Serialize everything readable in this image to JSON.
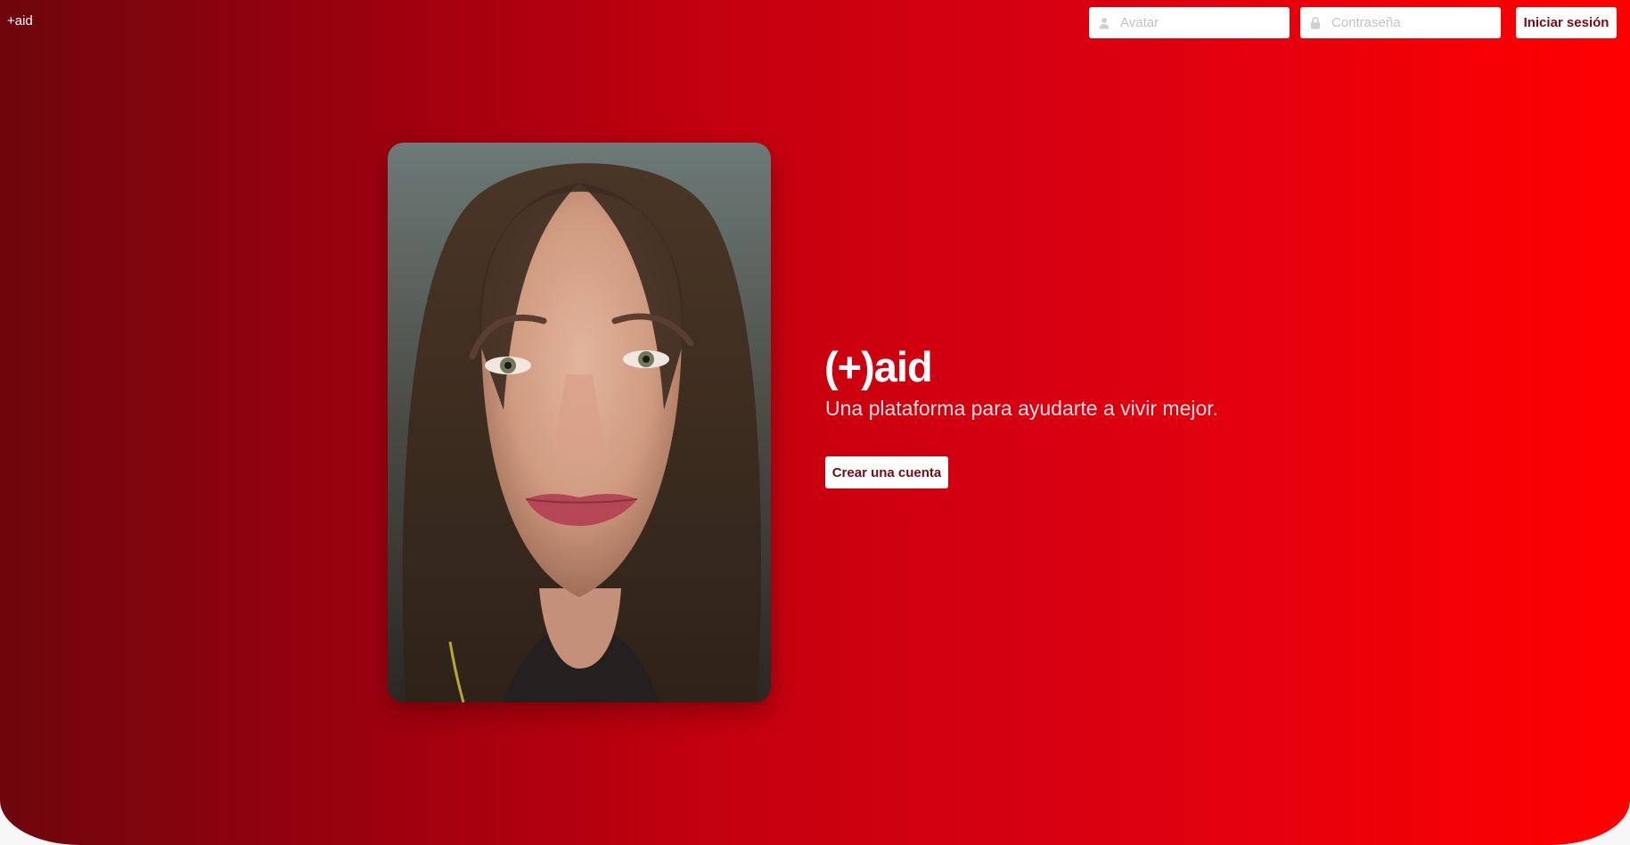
{
  "header": {
    "brand": "+aid",
    "login": {
      "username_placeholder": "Avatar",
      "username_icon": "user-icon",
      "password_placeholder": "Contraseña",
      "password_icon": "lock-icon",
      "submit_label": "Iniciar sesión"
    }
  },
  "hero": {
    "title": "(+)aid",
    "subtitle": "Una plataforma para ayudarte a vivir mejor.",
    "cta_label": "Crear una cuenta",
    "image": "portrait-photo"
  },
  "colors": {
    "gradient_start": "#6e060d",
    "gradient_end": "#ff0000",
    "button_text": "#7a0a12",
    "button_bg": "#ffffff"
  }
}
